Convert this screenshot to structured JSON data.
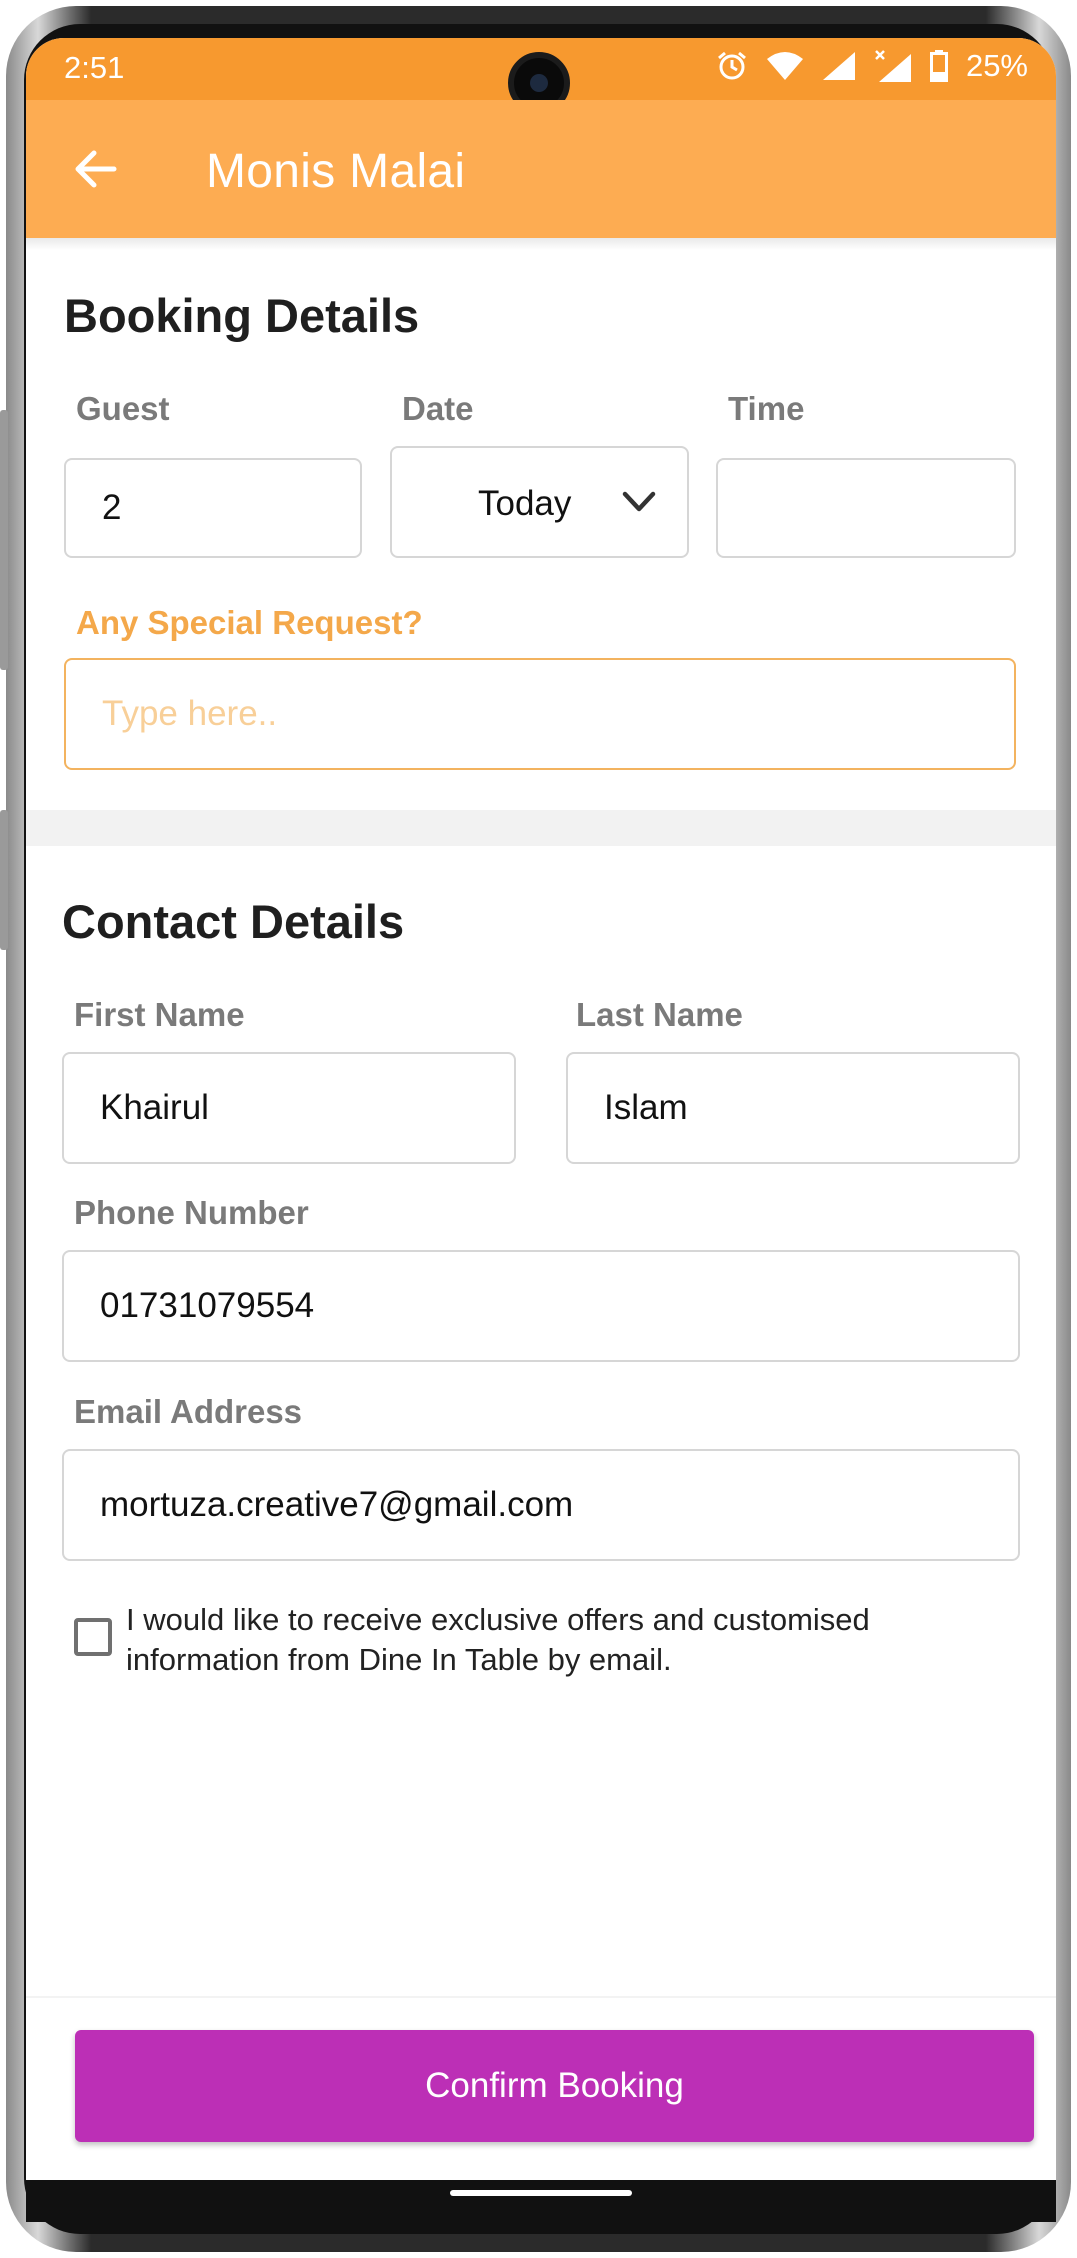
{
  "status_bar": {
    "time": "2:51",
    "battery": "25%",
    "icons": [
      "alarm-icon",
      "wifi-icon",
      "signal-icon",
      "signal-no-data-icon",
      "battery-icon"
    ]
  },
  "app_bar": {
    "title": "Monis Malai",
    "back_icon": "arrow-left-icon",
    "color": "#fdac52"
  },
  "booking": {
    "title": "Booking Details",
    "guest_label": "Guest",
    "guest_value": "2",
    "date_label": "Date",
    "date_value": "Today",
    "time_label": "Time",
    "time_value": "",
    "special_label": "Any Special Request?",
    "special_placeholder": "Type here.."
  },
  "contact": {
    "title": "Contact Details",
    "first_name_label": "First Name",
    "first_name_value": "Khairul",
    "last_name_label": "Last Name",
    "last_name_value": "Islam",
    "phone_label": "Phone Number",
    "phone_value": "01731079554",
    "email_label": "Email Address",
    "email_value": "mortuza.creative7@gmail.com",
    "consent_text": "I would like to receive exclusive offers and customised information from Dine In Table by email.",
    "consent_checked": false
  },
  "footer": {
    "confirm_label": "Confirm Booking",
    "confirm_color": "#bc2fb6"
  }
}
